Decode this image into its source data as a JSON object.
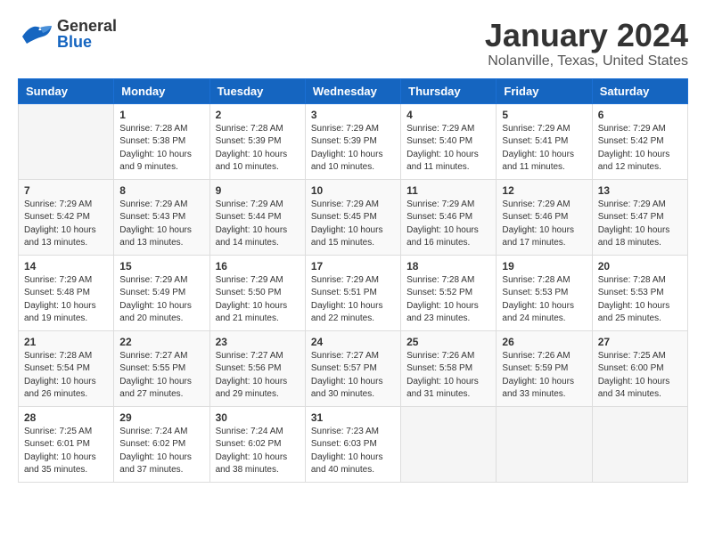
{
  "header": {
    "logo_general": "General",
    "logo_blue": "Blue",
    "main_title": "January 2024",
    "subtitle": "Nolanville, Texas, United States"
  },
  "calendar": {
    "days_of_week": [
      "Sunday",
      "Monday",
      "Tuesday",
      "Wednesday",
      "Thursday",
      "Friday",
      "Saturday"
    ],
    "weeks": [
      [
        {
          "day": "",
          "sunrise": "",
          "sunset": "",
          "daylight": "",
          "empty": true
        },
        {
          "day": "1",
          "sunrise": "Sunrise: 7:28 AM",
          "sunset": "Sunset: 5:38 PM",
          "daylight": "Daylight: 10 hours and 9 minutes."
        },
        {
          "day": "2",
          "sunrise": "Sunrise: 7:28 AM",
          "sunset": "Sunset: 5:39 PM",
          "daylight": "Daylight: 10 hours and 10 minutes."
        },
        {
          "day": "3",
          "sunrise": "Sunrise: 7:29 AM",
          "sunset": "Sunset: 5:39 PM",
          "daylight": "Daylight: 10 hours and 10 minutes."
        },
        {
          "day": "4",
          "sunrise": "Sunrise: 7:29 AM",
          "sunset": "Sunset: 5:40 PM",
          "daylight": "Daylight: 10 hours and 11 minutes."
        },
        {
          "day": "5",
          "sunrise": "Sunrise: 7:29 AM",
          "sunset": "Sunset: 5:41 PM",
          "daylight": "Daylight: 10 hours and 11 minutes."
        },
        {
          "day": "6",
          "sunrise": "Sunrise: 7:29 AM",
          "sunset": "Sunset: 5:42 PM",
          "daylight": "Daylight: 10 hours and 12 minutes."
        }
      ],
      [
        {
          "day": "7",
          "sunrise": "Sunrise: 7:29 AM",
          "sunset": "Sunset: 5:42 PM",
          "daylight": "Daylight: 10 hours and 13 minutes."
        },
        {
          "day": "8",
          "sunrise": "Sunrise: 7:29 AM",
          "sunset": "Sunset: 5:43 PM",
          "daylight": "Daylight: 10 hours and 13 minutes."
        },
        {
          "day": "9",
          "sunrise": "Sunrise: 7:29 AM",
          "sunset": "Sunset: 5:44 PM",
          "daylight": "Daylight: 10 hours and 14 minutes."
        },
        {
          "day": "10",
          "sunrise": "Sunrise: 7:29 AM",
          "sunset": "Sunset: 5:45 PM",
          "daylight": "Daylight: 10 hours and 15 minutes."
        },
        {
          "day": "11",
          "sunrise": "Sunrise: 7:29 AM",
          "sunset": "Sunset: 5:46 PM",
          "daylight": "Daylight: 10 hours and 16 minutes."
        },
        {
          "day": "12",
          "sunrise": "Sunrise: 7:29 AM",
          "sunset": "Sunset: 5:46 PM",
          "daylight": "Daylight: 10 hours and 17 minutes."
        },
        {
          "day": "13",
          "sunrise": "Sunrise: 7:29 AM",
          "sunset": "Sunset: 5:47 PM",
          "daylight": "Daylight: 10 hours and 18 minutes."
        }
      ],
      [
        {
          "day": "14",
          "sunrise": "Sunrise: 7:29 AM",
          "sunset": "Sunset: 5:48 PM",
          "daylight": "Daylight: 10 hours and 19 minutes."
        },
        {
          "day": "15",
          "sunrise": "Sunrise: 7:29 AM",
          "sunset": "Sunset: 5:49 PM",
          "daylight": "Daylight: 10 hours and 20 minutes."
        },
        {
          "day": "16",
          "sunrise": "Sunrise: 7:29 AM",
          "sunset": "Sunset: 5:50 PM",
          "daylight": "Daylight: 10 hours and 21 minutes."
        },
        {
          "day": "17",
          "sunrise": "Sunrise: 7:29 AM",
          "sunset": "Sunset: 5:51 PM",
          "daylight": "Daylight: 10 hours and 22 minutes."
        },
        {
          "day": "18",
          "sunrise": "Sunrise: 7:28 AM",
          "sunset": "Sunset: 5:52 PM",
          "daylight": "Daylight: 10 hours and 23 minutes."
        },
        {
          "day": "19",
          "sunrise": "Sunrise: 7:28 AM",
          "sunset": "Sunset: 5:53 PM",
          "daylight": "Daylight: 10 hours and 24 minutes."
        },
        {
          "day": "20",
          "sunrise": "Sunrise: 7:28 AM",
          "sunset": "Sunset: 5:53 PM",
          "daylight": "Daylight: 10 hours and 25 minutes."
        }
      ],
      [
        {
          "day": "21",
          "sunrise": "Sunrise: 7:28 AM",
          "sunset": "Sunset: 5:54 PM",
          "daylight": "Daylight: 10 hours and 26 minutes."
        },
        {
          "day": "22",
          "sunrise": "Sunrise: 7:27 AM",
          "sunset": "Sunset: 5:55 PM",
          "daylight": "Daylight: 10 hours and 27 minutes."
        },
        {
          "day": "23",
          "sunrise": "Sunrise: 7:27 AM",
          "sunset": "Sunset: 5:56 PM",
          "daylight": "Daylight: 10 hours and 29 minutes."
        },
        {
          "day": "24",
          "sunrise": "Sunrise: 7:27 AM",
          "sunset": "Sunset: 5:57 PM",
          "daylight": "Daylight: 10 hours and 30 minutes."
        },
        {
          "day": "25",
          "sunrise": "Sunrise: 7:26 AM",
          "sunset": "Sunset: 5:58 PM",
          "daylight": "Daylight: 10 hours and 31 minutes."
        },
        {
          "day": "26",
          "sunrise": "Sunrise: 7:26 AM",
          "sunset": "Sunset: 5:59 PM",
          "daylight": "Daylight: 10 hours and 33 minutes."
        },
        {
          "day": "27",
          "sunrise": "Sunrise: 7:25 AM",
          "sunset": "Sunset: 6:00 PM",
          "daylight": "Daylight: 10 hours and 34 minutes."
        }
      ],
      [
        {
          "day": "28",
          "sunrise": "Sunrise: 7:25 AM",
          "sunset": "Sunset: 6:01 PM",
          "daylight": "Daylight: 10 hours and 35 minutes."
        },
        {
          "day": "29",
          "sunrise": "Sunrise: 7:24 AM",
          "sunset": "Sunset: 6:02 PM",
          "daylight": "Daylight: 10 hours and 37 minutes."
        },
        {
          "day": "30",
          "sunrise": "Sunrise: 7:24 AM",
          "sunset": "Sunset: 6:02 PM",
          "daylight": "Daylight: 10 hours and 38 minutes."
        },
        {
          "day": "31",
          "sunrise": "Sunrise: 7:23 AM",
          "sunset": "Sunset: 6:03 PM",
          "daylight": "Daylight: 10 hours and 40 minutes."
        },
        {
          "day": "",
          "sunrise": "",
          "sunset": "",
          "daylight": "",
          "empty": true
        },
        {
          "day": "",
          "sunrise": "",
          "sunset": "",
          "daylight": "",
          "empty": true
        },
        {
          "day": "",
          "sunrise": "",
          "sunset": "",
          "daylight": "",
          "empty": true
        }
      ]
    ]
  }
}
